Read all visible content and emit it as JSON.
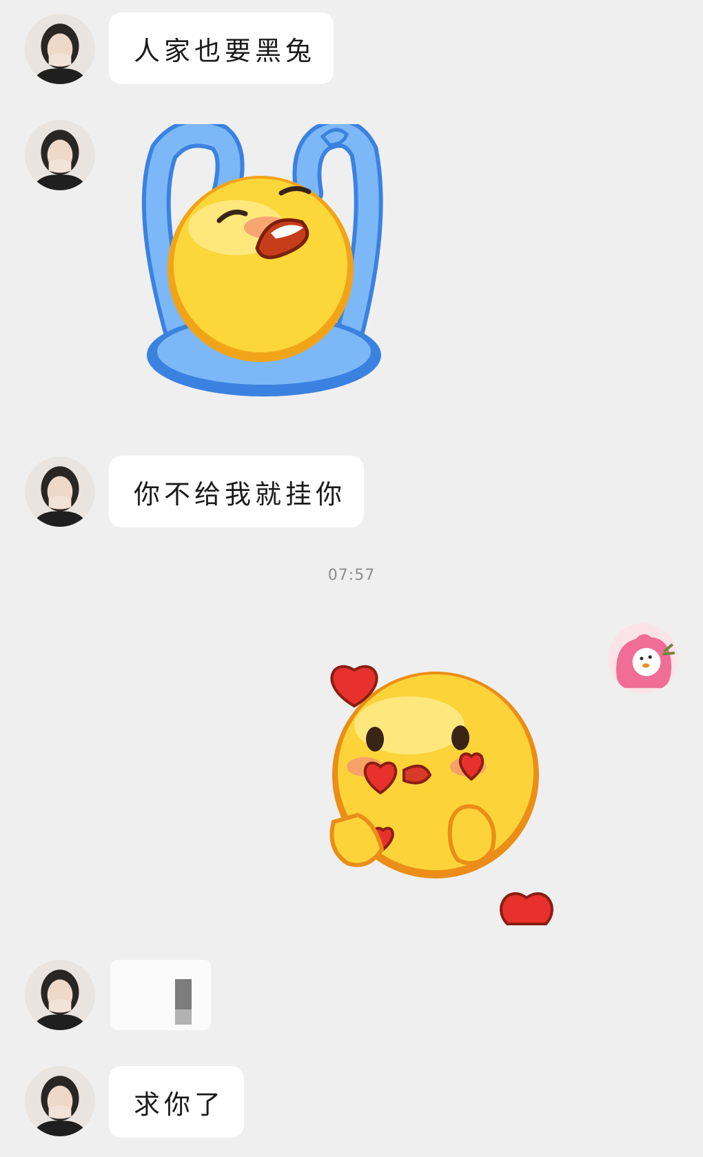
{
  "messages": {
    "msg1": {
      "sender": "contact",
      "text": "人家也要黑兔"
    },
    "msg2": {
      "sender": "contact",
      "sticker": "crying-bunny-emoji-sticker"
    },
    "msg3": {
      "sender": "contact",
      "text": "你不给我就挂你"
    },
    "timestamp": "07:57",
    "msg4": {
      "sender": "me",
      "sticker": "heart-kiss-emoji-sticker"
    },
    "msg5": {
      "sender": "contact",
      "text": ""
    },
    "msg6": {
      "sender": "contact",
      "text": "求你了"
    }
  },
  "colors": {
    "background": "#efefef",
    "bubble": "#ffffff",
    "text": "#1a1a1a",
    "timestamp": "#8c8c8c"
  }
}
